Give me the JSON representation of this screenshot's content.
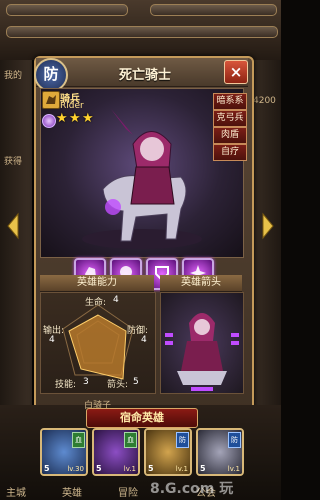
{
  "background": {
    "left_labels": [
      "我的",
      "获得"
    ],
    "right_label": "4200",
    "bottom_left_tabs": [
      "主城",
      "英雄",
      "冒险"
    ],
    "bottom_right_tabs": [
      "公会"
    ],
    "mid_label": "白骑子"
  },
  "panel": {
    "badge": "防",
    "title": "死亡骑士",
    "close": "×"
  },
  "hero": {
    "class_cn": "骑兵",
    "class_en": "Rider",
    "stars": 3,
    "tags": [
      "暗系系",
      "克弓兵",
      "肉盾",
      "自疗"
    ]
  },
  "skills": [
    "skill-1",
    "skill-2",
    "skill-3",
    "skill-4"
  ],
  "ability": {
    "header": "英雄能力",
    "hp_label": "生命:",
    "hp_value": "4",
    "atk_label": "输出:",
    "atk_value": "4",
    "def_label": "防御:",
    "def_value": "4",
    "skill_label": "技能:",
    "skill_value": "3",
    "arrow_label": "箭头:",
    "arrow_value": "5",
    "radar": [
      4,
      4,
      5,
      3,
      4
    ]
  },
  "arrow_section": {
    "header": "英雄箭头"
  },
  "fate": {
    "banner": "宿命英雄",
    "heroes": [
      {
        "num": "5",
        "level": "lv.30",
        "role": "血",
        "color": "#3b6aa8"
      },
      {
        "num": "5",
        "level": "lv.1",
        "role": "血",
        "color": "#5a2e8a"
      },
      {
        "num": "5",
        "level": "lv.1",
        "role": "防",
        "color": "#a07a2a"
      },
      {
        "num": "5",
        "level": "lv.1",
        "role": "防",
        "color": "#6a6a7a"
      }
    ]
  },
  "watermark": "8.G.com 玩"
}
